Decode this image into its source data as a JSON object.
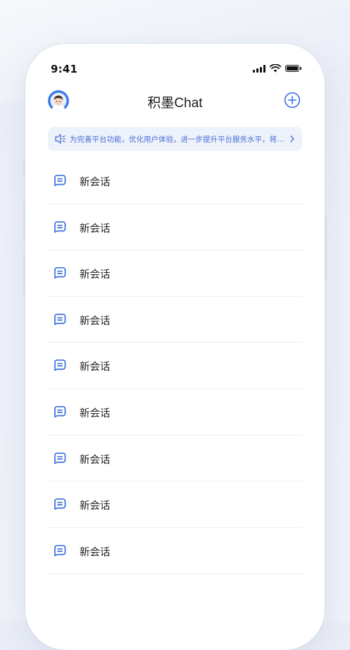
{
  "status_bar": {
    "time": "9:41"
  },
  "header": {
    "title": "积墨Chat"
  },
  "notice": {
    "text": "为完善平台功能，优化用户体验，进一步提升平台服务水平，将…"
  },
  "conversations": [
    {
      "label": "新会话"
    },
    {
      "label": "新会话"
    },
    {
      "label": "新会话"
    },
    {
      "label": "新会话"
    },
    {
      "label": "新会话"
    },
    {
      "label": "新会话"
    },
    {
      "label": "新会话"
    },
    {
      "label": "新会话"
    },
    {
      "label": "新会话"
    }
  ],
  "colors": {
    "accent": "#3b6fe0",
    "notice_bg": "#eef2fb",
    "notice_text": "#4a6fd6"
  },
  "icons": {
    "avatar": "user-avatar",
    "add": "plus-circle-icon",
    "notice": "speaker-icon",
    "notice_more": "chevron-right-icon",
    "conversation": "chat-bubble-icon"
  }
}
